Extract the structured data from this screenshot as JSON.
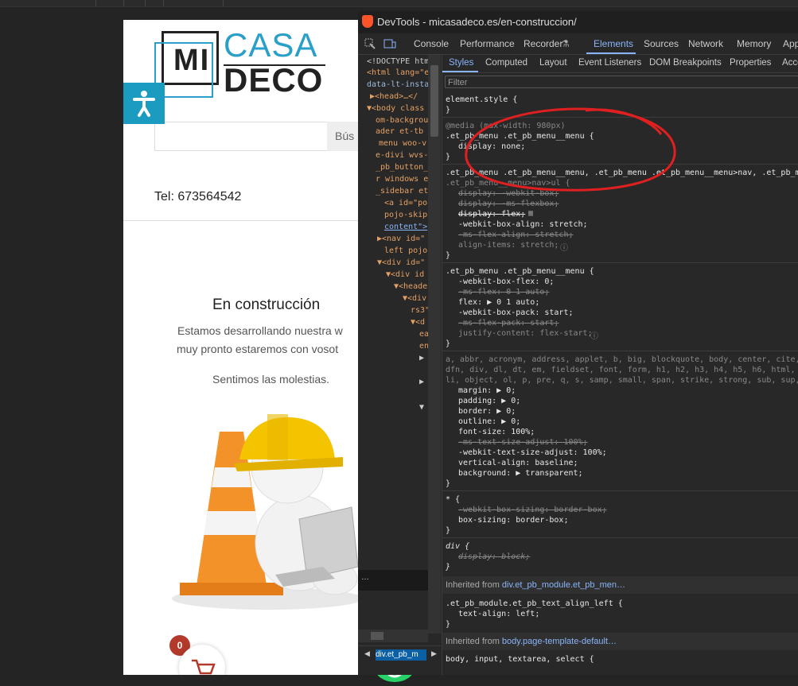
{
  "browser": {
    "tick_marks": 5
  },
  "site": {
    "logo": {
      "mi": "MI",
      "casa": "CASA",
      "deco": "DECO"
    },
    "search_placeholder": "Bús",
    "tel": "Tel: 673564542",
    "title": "En construcción",
    "line1": "Estamos desarrollando nuestra w",
    "line2": "muy pronto estaremos con vosot",
    "line3": "Sentimos las molestias.",
    "cart_count": "0"
  },
  "devtools": {
    "title": "DevTools - micasadeco.es/en-construccion/",
    "tabs": [
      "Console",
      "Performance",
      "Recorder",
      "Elements",
      "Sources",
      "Network",
      "Memory",
      "App"
    ],
    "style_tabs": [
      "Styles",
      "Computed",
      "Layout",
      "Event Listeners",
      "DOM Breakpoints",
      "Properties",
      "Acce"
    ],
    "filter_placeholder": "Filter",
    "breadcrumb": "div.et_pb_m",
    "dom_lines": [
      "<!DOCTYPE htm",
      "<html lang=\"e",
      "data-lt-insta",
      "▶<head>…</",
      "▼<body class",
      "om-backgrou",
      "ader et-tb",
      "menu woo-v",
      "e-divi wvs-",
      "_pb_button_",
      "r windows e",
      "_sidebar et",
      "<a id=\"po",
      "pojo-skip",
      "content\">",
      "▶<nav id=\"",
      "left pojo",
      "▼<div id=\"",
      "▼<div id",
      "▼<heade",
      "▼<div",
      "rs3\"",
      "▼<d",
      "ea",
      "en",
      "▶",
      "▶",
      "▼"
    ],
    "styles_lines": {
      "element_style": "element.style {",
      "close": "}",
      "media": "@media (max-width: 980px)",
      "sel1": ".et_pb_menu .et_pb_menu__menu {",
      "display_none": "display: none;",
      "sel2": ".et_pb_menu .et_pb_menu__menu, .et_pb_menu .et_pb_menu__menu>nav, .et_pb_m",
      "sel2b": ".et_pb_menu__menu>nav>ul {",
      "p_wbox": "display: -webkit-box;",
      "p_msflexbox": "display: -ms-flexbox;",
      "p_flex": "display: flex;",
      "p_wkalign": "-webkit-box-align: stretch;",
      "p_msalign": "-ms-flex-align: stretch;",
      "p_align": "align-items: stretch;",
      "sel3": ".et_pb_menu .et_pb_menu__menu {",
      "p_wkflex": "-webkit-box-flex: 0;",
      "p_msflex": "-ms-flex: 0 1 auto;",
      "p_flexauto": "flex: ▶ 0 1 auto;",
      "p_wkpack": "-webkit-box-pack: start;",
      "p_mspack": "-ms-flex-pack: start;",
      "p_justify": "justify-content: flex-start;",
      "reset1": "a, abbr, acronym, address, applet, b, big, blockquote, body, center, cite, c",
      "reset2": "dfn, div, dl, dt, em, fieldset, font, form, h1, h2, h3, h4, h5, h6, html, i",
      "reset3": "li, object, ol, p, pre, q, s, samp, small, span, strike, strong, sub, sup, t",
      "p_margin": "margin: ▶ 0;",
      "p_padding": "padding: ▶ 0;",
      "p_border": "border: ▶ 0;",
      "p_outline": "outline: ▶ 0;",
      "p_fontsize": "font-size: 100%;",
      "p_mstext": "-ms-text-size-adjust: 100%;",
      "p_wktext": "-webkit-text-size-adjust: 100%;",
      "p_valign": "vertical-align: baseline;",
      "p_bg": "background: ▶ transparent;",
      "star": "* {",
      "p_wkbox": "-webkit-box-sizing: border-box;",
      "p_box": "box-sizing: border-box;",
      "div": "div {",
      "p_block": "display: block;",
      "inh1_pre": "Inherited from ",
      "inh1": "div.et_pb_module.et_pb_men…",
      "sel4": ".et_pb_module.et_pb_text_align_left {",
      "p_textalign": "text-align: left;",
      "inh2_pre": "Inherited from ",
      "inh2": "body.page-template-default…",
      "last": "body, input, textarea, select {"
    }
  }
}
